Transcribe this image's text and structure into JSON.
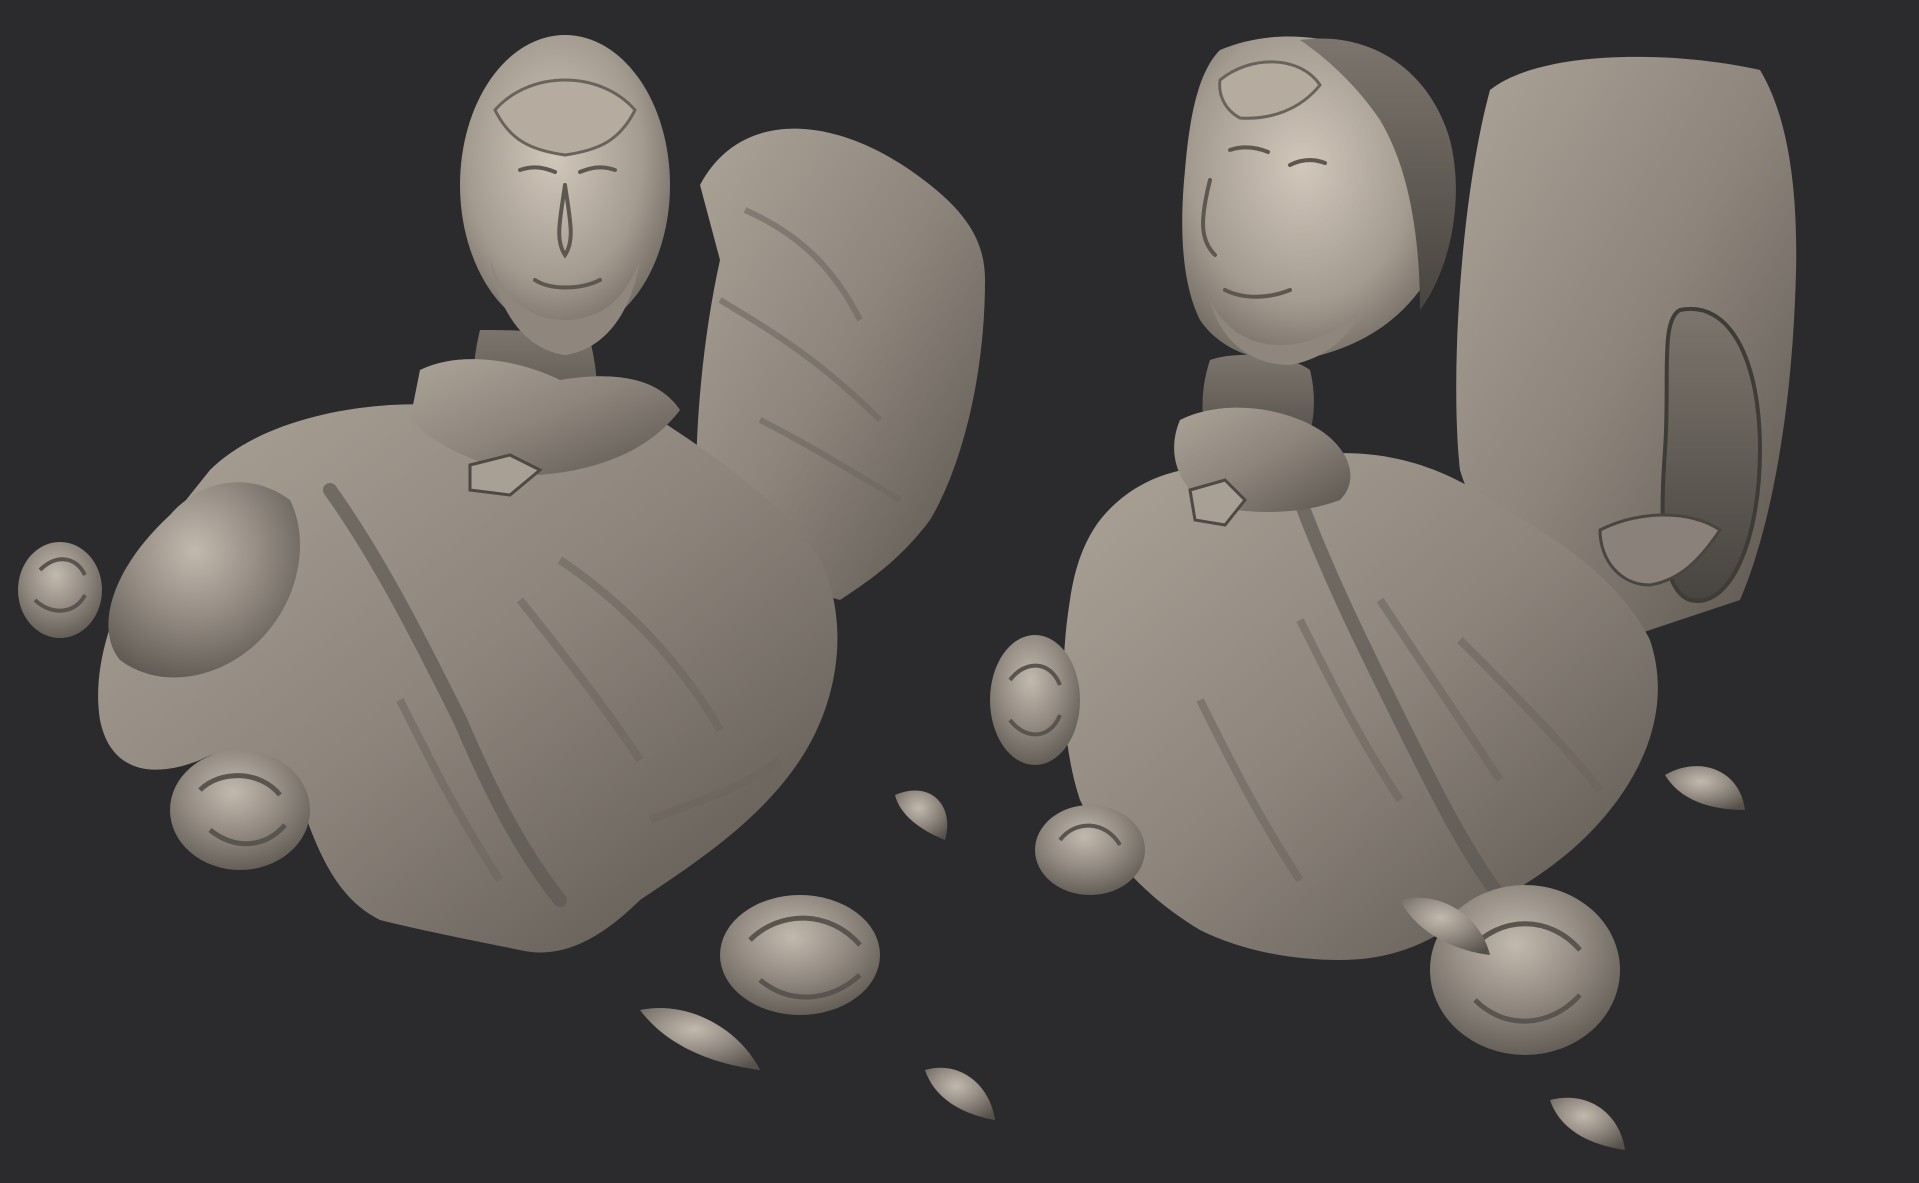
{
  "scene": {
    "background_color": "#2b2b2d",
    "material_color": "#8f8880",
    "material_highlight": "#b9b1a7",
    "material_shadow": "#4e4944",
    "subjects": [
      "sculpt-front-view",
      "sculpt-three-quarter-view"
    ]
  }
}
